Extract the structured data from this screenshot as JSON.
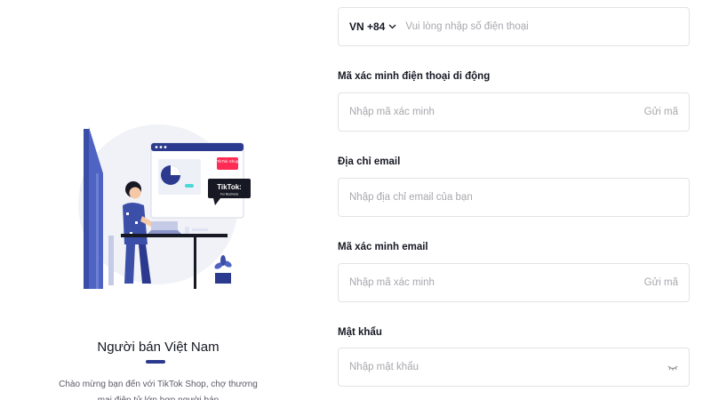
{
  "seller": {
    "title": "Người bán Việt Nam",
    "description": "Chào mừng bạn đến với TikTok Shop, chợ thương mại điện tử lớn hơn người bán"
  },
  "illustration": {
    "tiktok_shop_badge": "TikTok Shop",
    "tiktok_business_badge": "TikTok:",
    "tiktok_business_sub": "For Business"
  },
  "form": {
    "phone": {
      "country_code": "VN +84",
      "placeholder": "Vui lòng nhập số điện thoại"
    },
    "phone_code": {
      "label": "Mã xác minh điện thoại di động",
      "placeholder": "Nhập mã xác minh",
      "send_label": "Gửi mã"
    },
    "email": {
      "label": "Địa chỉ email",
      "placeholder": "Nhập địa chỉ email của bạn"
    },
    "email_code": {
      "label": "Mã xác minh email",
      "placeholder": "Nhập mã xác minh",
      "send_label": "Gửi mã"
    },
    "password": {
      "label": "Mật khẩu",
      "placeholder": "Nhập mật khẩu"
    }
  },
  "icons": {
    "chevron": "chevron-down-icon",
    "password_toggle": "eye-closed-icon"
  },
  "colors": {
    "accent": "#2b3a8e",
    "tiktok_red": "#fe2c55",
    "text": "#161823",
    "placeholder": "#a7a8ad",
    "border": "#e3e3e6"
  }
}
